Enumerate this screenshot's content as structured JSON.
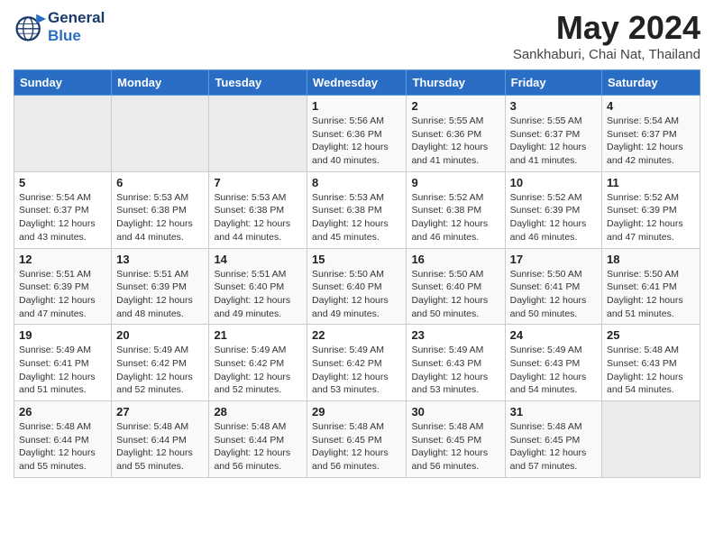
{
  "header": {
    "logo_line1": "General",
    "logo_line2": "Blue",
    "month_title": "May 2024",
    "subtitle": "Sankhaburi, Chai Nat, Thailand"
  },
  "days_of_week": [
    "Sunday",
    "Monday",
    "Tuesday",
    "Wednesday",
    "Thursday",
    "Friday",
    "Saturday"
  ],
  "weeks": [
    [
      {
        "day": null
      },
      {
        "day": null
      },
      {
        "day": null
      },
      {
        "day": "1",
        "sunrise": "5:56 AM",
        "sunset": "6:36 PM",
        "daylight": "12 hours and 40 minutes."
      },
      {
        "day": "2",
        "sunrise": "5:55 AM",
        "sunset": "6:36 PM",
        "daylight": "12 hours and 41 minutes."
      },
      {
        "day": "3",
        "sunrise": "5:55 AM",
        "sunset": "6:37 PM",
        "daylight": "12 hours and 41 minutes."
      },
      {
        "day": "4",
        "sunrise": "5:54 AM",
        "sunset": "6:37 PM",
        "daylight": "12 hours and 42 minutes."
      }
    ],
    [
      {
        "day": "5",
        "sunrise": "5:54 AM",
        "sunset": "6:37 PM",
        "daylight": "12 hours and 43 minutes."
      },
      {
        "day": "6",
        "sunrise": "5:53 AM",
        "sunset": "6:38 PM",
        "daylight": "12 hours and 44 minutes."
      },
      {
        "day": "7",
        "sunrise": "5:53 AM",
        "sunset": "6:38 PM",
        "daylight": "12 hours and 44 minutes."
      },
      {
        "day": "8",
        "sunrise": "5:53 AM",
        "sunset": "6:38 PM",
        "daylight": "12 hours and 45 minutes."
      },
      {
        "day": "9",
        "sunrise": "5:52 AM",
        "sunset": "6:38 PM",
        "daylight": "12 hours and 46 minutes."
      },
      {
        "day": "10",
        "sunrise": "5:52 AM",
        "sunset": "6:39 PM",
        "daylight": "12 hours and 46 minutes."
      },
      {
        "day": "11",
        "sunrise": "5:52 AM",
        "sunset": "6:39 PM",
        "daylight": "12 hours and 47 minutes."
      }
    ],
    [
      {
        "day": "12",
        "sunrise": "5:51 AM",
        "sunset": "6:39 PM",
        "daylight": "12 hours and 47 minutes."
      },
      {
        "day": "13",
        "sunrise": "5:51 AM",
        "sunset": "6:39 PM",
        "daylight": "12 hours and 48 minutes."
      },
      {
        "day": "14",
        "sunrise": "5:51 AM",
        "sunset": "6:40 PM",
        "daylight": "12 hours and 49 minutes."
      },
      {
        "day": "15",
        "sunrise": "5:50 AM",
        "sunset": "6:40 PM",
        "daylight": "12 hours and 49 minutes."
      },
      {
        "day": "16",
        "sunrise": "5:50 AM",
        "sunset": "6:40 PM",
        "daylight": "12 hours and 50 minutes."
      },
      {
        "day": "17",
        "sunrise": "5:50 AM",
        "sunset": "6:41 PM",
        "daylight": "12 hours and 50 minutes."
      },
      {
        "day": "18",
        "sunrise": "5:50 AM",
        "sunset": "6:41 PM",
        "daylight": "12 hours and 51 minutes."
      }
    ],
    [
      {
        "day": "19",
        "sunrise": "5:49 AM",
        "sunset": "6:41 PM",
        "daylight": "12 hours and 51 minutes."
      },
      {
        "day": "20",
        "sunrise": "5:49 AM",
        "sunset": "6:42 PM",
        "daylight": "12 hours and 52 minutes."
      },
      {
        "day": "21",
        "sunrise": "5:49 AM",
        "sunset": "6:42 PM",
        "daylight": "12 hours and 52 minutes."
      },
      {
        "day": "22",
        "sunrise": "5:49 AM",
        "sunset": "6:42 PM",
        "daylight": "12 hours and 53 minutes."
      },
      {
        "day": "23",
        "sunrise": "5:49 AM",
        "sunset": "6:43 PM",
        "daylight": "12 hours and 53 minutes."
      },
      {
        "day": "24",
        "sunrise": "5:49 AM",
        "sunset": "6:43 PM",
        "daylight": "12 hours and 54 minutes."
      },
      {
        "day": "25",
        "sunrise": "5:48 AM",
        "sunset": "6:43 PM",
        "daylight": "12 hours and 54 minutes."
      }
    ],
    [
      {
        "day": "26",
        "sunrise": "5:48 AM",
        "sunset": "6:44 PM",
        "daylight": "12 hours and 55 minutes."
      },
      {
        "day": "27",
        "sunrise": "5:48 AM",
        "sunset": "6:44 PM",
        "daylight": "12 hours and 55 minutes."
      },
      {
        "day": "28",
        "sunrise": "5:48 AM",
        "sunset": "6:44 PM",
        "daylight": "12 hours and 56 minutes."
      },
      {
        "day": "29",
        "sunrise": "5:48 AM",
        "sunset": "6:45 PM",
        "daylight": "12 hours and 56 minutes."
      },
      {
        "day": "30",
        "sunrise": "5:48 AM",
        "sunset": "6:45 PM",
        "daylight": "12 hours and 56 minutes."
      },
      {
        "day": "31",
        "sunrise": "5:48 AM",
        "sunset": "6:45 PM",
        "daylight": "12 hours and 57 minutes."
      },
      {
        "day": null
      }
    ]
  ],
  "labels": {
    "sunrise": "Sunrise:",
    "sunset": "Sunset:",
    "daylight": "Daylight:"
  }
}
